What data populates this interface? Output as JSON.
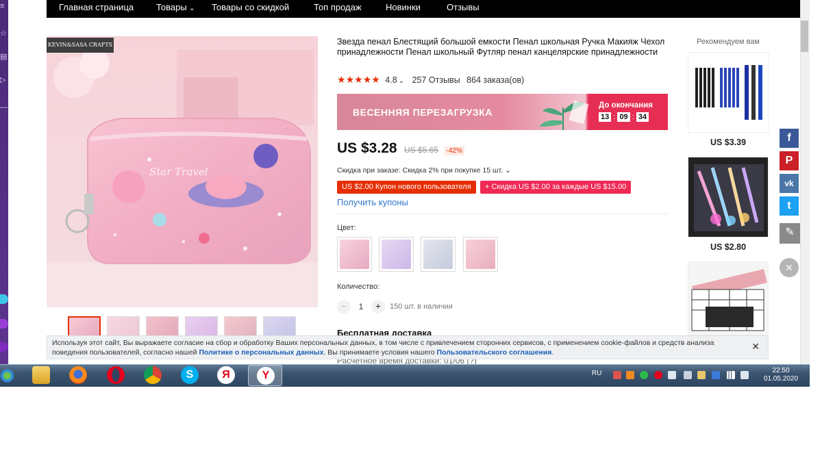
{
  "nav": {
    "items": [
      "Главная страница",
      "Товары",
      "Товары со скидкой",
      "Топ продаж",
      "Новинки",
      "Отзывы"
    ]
  },
  "gallery": {
    "brand_label": "KEVIN&SASA CRAFTS",
    "product_image_text": "Star Travel",
    "thumbnail_count": 6
  },
  "product": {
    "title": "Звезда пенал Блестящий большой емкости Пенал школьная Ручка Макияж Чехол принадлежности Пенал школьный Футляр пенал канцелярские принадлежности",
    "rating": "4.8",
    "reviews": "257 Отзывы",
    "orders": "864 заказа(ов)"
  },
  "banner": {
    "title": "ВЕСЕННЯЯ ПЕРЕЗАГРУЗКА",
    "countdown_label": "До окончания",
    "hours": "13",
    "minutes": "09",
    "seconds": "34",
    "sep": ":"
  },
  "price": {
    "current": "US $3.28",
    "old": "US $5.65",
    "discount": "-42%",
    "order_discount": "Скидка при заказе: Скидка 2% при покупке 15 шт.",
    "coupon_new_user": "US $2.00 Купон нового пользователя",
    "coupon_every": "+ Скидка US $2.00 за каждые US $15.00",
    "get_coupons": "Получить купоны"
  },
  "options": {
    "color_label": "Цвет:",
    "colors": [
      "#f3c6d3",
      "#d9c8ee",
      "#d5d8e6",
      "#f2c2cc"
    ],
    "quantity_label": "Количество:",
    "quantity": "1",
    "stock": "150 шт. в наличии",
    "minus": "−",
    "plus": "+"
  },
  "shipping": {
    "title": "Бесплатная доставка",
    "partial": "Расчетное время доставки: 01/06 (?)"
  },
  "recommend": {
    "title": "Рекомендуем вам",
    "prices": [
      "US $3.39",
      "US $2.80"
    ]
  },
  "social": {
    "facebook": "f",
    "pinterest": "P",
    "vk": "vk",
    "twitter": "t",
    "edit": "✎",
    "close": "✕"
  },
  "cookie": {
    "text1": "Используя этот сайт, Вы выражаете согласие на сбор и обработку Ваших персональных данных, в том числе с привлечением сторонних сервисов, с применением cookie-файлов и средств анализа поведения пользователей, согласно нашей ",
    "link1": "Политике о персональных данных",
    "text2": ". Вы принимаете условия нашего ",
    "link2": "Пользовательского соглашения",
    "text3": ".",
    "close": "✕"
  },
  "taskbar": {
    "lang": "RU",
    "time": "22:50",
    "date": "01.05.2020"
  }
}
